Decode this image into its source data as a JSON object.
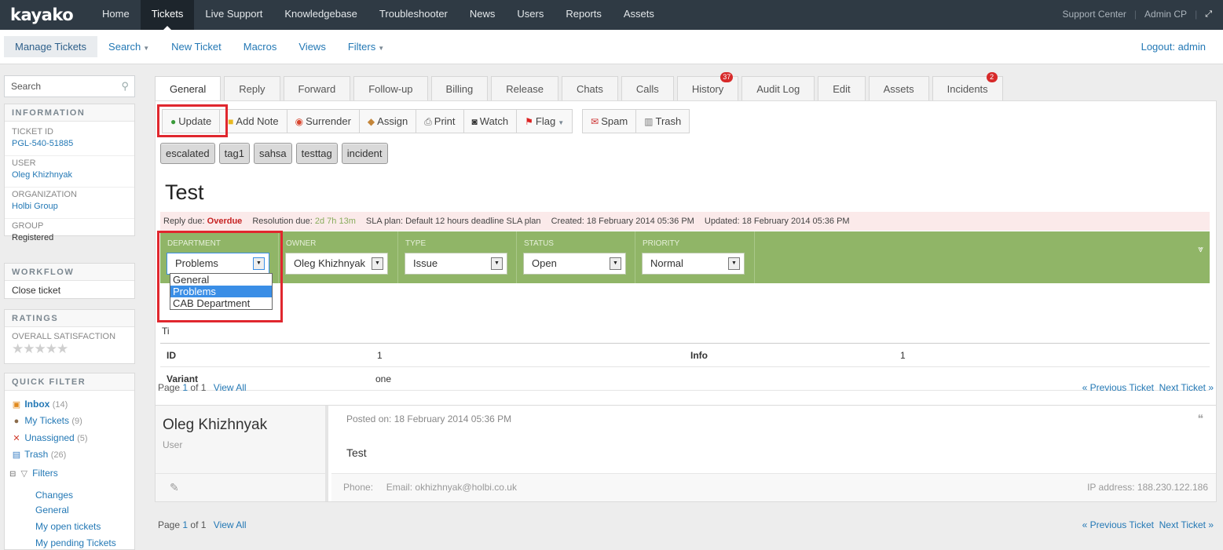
{
  "topbar": {
    "logo": "kayako",
    "nav": [
      "Home",
      "Tickets",
      "Live Support",
      "Knowledgebase",
      "Troubleshooter",
      "News",
      "Users",
      "Reports",
      "Assets"
    ],
    "active": "Tickets",
    "support_center": "Support Center",
    "admin_cp": "Admin CP",
    "divider": "|"
  },
  "subbar": {
    "manage": "Manage Tickets",
    "search": "Search",
    "new_ticket": "New Ticket",
    "macros": "Macros",
    "views": "Views",
    "filters": "Filters",
    "logout": "Logout: admin"
  },
  "sidebar": {
    "search_placeholder": "Search",
    "information": {
      "header": "INFORMATION",
      "ticket_id_label": "TICKET ID",
      "ticket_id": "PGL-540-51885",
      "user_label": "USER",
      "user": "Oleg Khizhnyak",
      "org_label": "ORGANIZATION",
      "org": "Holbi Group",
      "group_label": "GROUP",
      "group": "Registered"
    },
    "workflow": {
      "header": "WORKFLOW",
      "item": "Close ticket"
    },
    "ratings": {
      "header": "RATINGS",
      "label": "OVERALL SATISFACTION",
      "stars": "★★★★★"
    },
    "quick_filter": {
      "header": "QUICK FILTER",
      "inbox": "Inbox",
      "inbox_count": "(14)",
      "my_tickets": "My Tickets",
      "my_tickets_count": "(9)",
      "unassigned": "Unassigned",
      "unassigned_count": "(5)",
      "trash": "Trash",
      "trash_count": "(26)",
      "filters": "Filters",
      "changes": "Changes",
      "general": "General",
      "my_open": "My open tickets",
      "my_pending": "My pending Tickets"
    }
  },
  "tabs": [
    {
      "label": "General"
    },
    {
      "label": "Reply"
    },
    {
      "label": "Forward"
    },
    {
      "label": "Follow-up"
    },
    {
      "label": "Billing"
    },
    {
      "label": "Release"
    },
    {
      "label": "Chats"
    },
    {
      "label": "Calls"
    },
    {
      "label": "History",
      "badge": "37"
    },
    {
      "label": "Audit Log"
    },
    {
      "label": "Edit"
    },
    {
      "label": "Assets"
    },
    {
      "label": "Incidents",
      "badge": "2"
    }
  ],
  "toolbar": {
    "update": "Update",
    "add_note": "Add Note",
    "surrender": "Surrender",
    "assign": "Assign",
    "print": "Print",
    "watch": "Watch",
    "flag": "Flag",
    "spam": "Spam",
    "trash": "Trash"
  },
  "tags": [
    "escalated",
    "tag1",
    "sahsa",
    "testtag",
    "incident"
  ],
  "ticket": {
    "title": "Test",
    "reply_due_label": "Reply due:",
    "reply_due": "Overdue",
    "resolution_due_label": "Resolution due:",
    "resolution_due": "2d 7h 13m",
    "sla_plan": "SLA plan: Default 12 hours deadline SLA plan",
    "created": "Created: 18 February 2014 05:36 PM",
    "updated": "Updated: 18 February 2014 05:36 PM"
  },
  "properties": {
    "department_label": "DEPARTMENT",
    "department": "Problems",
    "owner_label": "OWNER",
    "owner": "Oleg Khizhnyak",
    "type_label": "TYPE",
    "type": "Issue",
    "status_label": "STATUS",
    "status": "Open",
    "priority_label": "PRIORITY",
    "priority": "Normal"
  },
  "department_options": [
    "General",
    "Problems",
    "CAB Department"
  ],
  "fields": {
    "table_title_partial": "Ti",
    "id_label": "ID",
    "id_value": "1",
    "info_label": "Info",
    "info_value": "1",
    "variant_label": "Variant",
    "variant_value": "one"
  },
  "pager": {
    "page_label": "Page",
    "page": "1",
    "of_label": "of",
    "total": "1",
    "view_all": "View All",
    "prev": "« Previous Ticket",
    "next": "Next Ticket »"
  },
  "post": {
    "author": "Oleg Khizhnyak",
    "role": "User",
    "posted": "Posted on: 18 February 2014 05:36 PM",
    "body": "Test",
    "phone": "Phone:",
    "email": "Email: okhizhnyak@holbi.co.uk",
    "ip": "IP address: 188.230.122.186"
  },
  "colors": {
    "topbar": "#2f3a44",
    "accent": "#2378b5",
    "props_bar": "#90b567",
    "highlight": "#e0272e"
  }
}
